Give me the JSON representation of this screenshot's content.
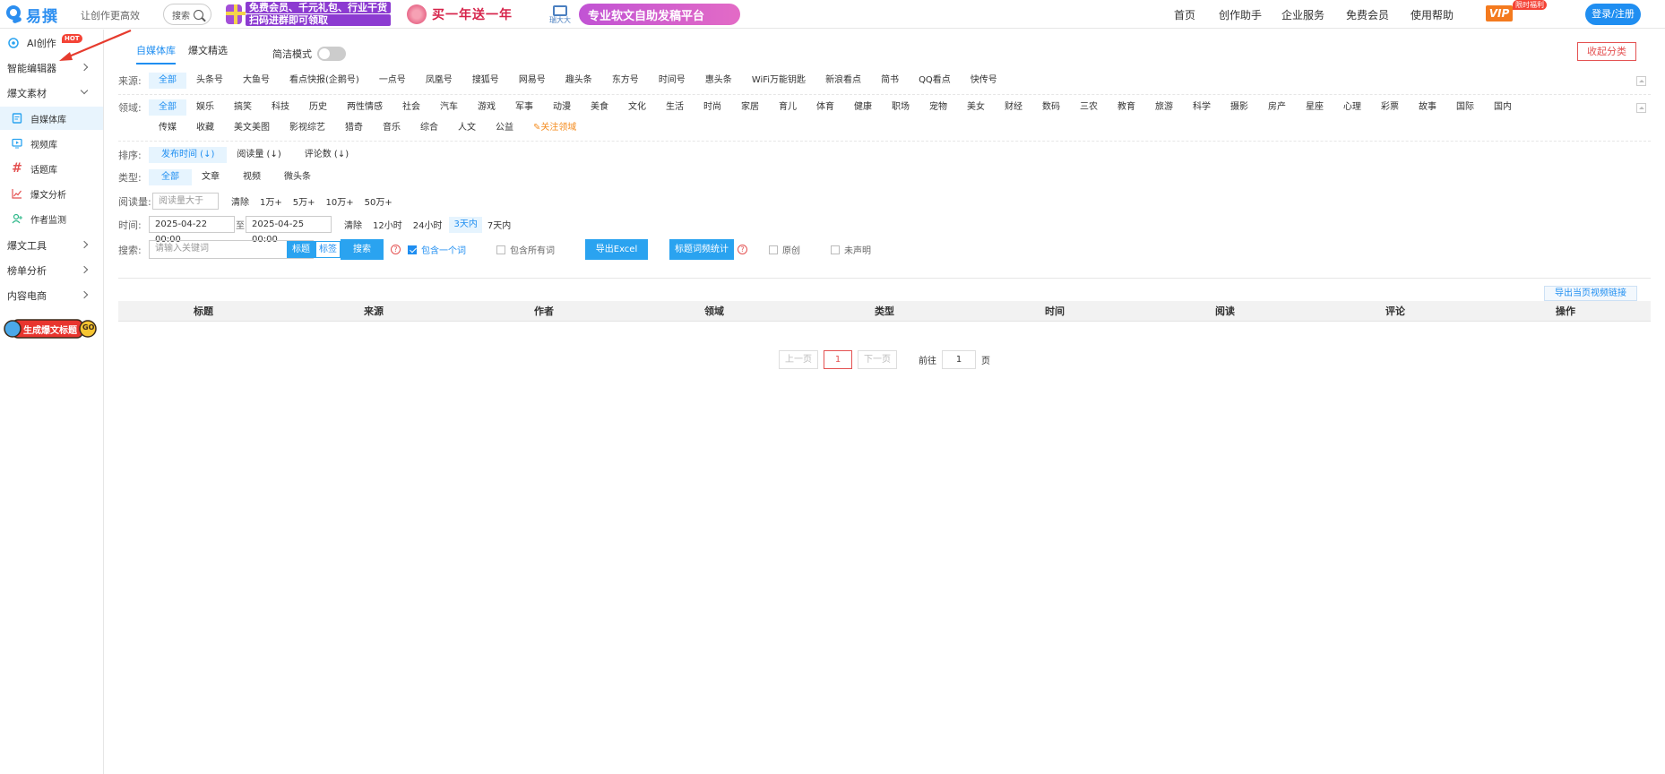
{
  "header": {
    "logo_text": "易撰",
    "tagline": "让创作更高效",
    "search_label": "搜索",
    "banner1_line1": "免费会员、千元礼包、行业干货",
    "banner1_line2": "扫码进群即可领取",
    "banner2_text": "买一年送一年",
    "banner3_brand": "瑞大大",
    "banner3_text": "专业软文自助发稿平台",
    "nav": [
      "首页",
      "创作助手",
      "企业服务",
      "免费会员",
      "使用帮助"
    ],
    "vip": "VIP",
    "vip_tag": "限时福利",
    "login": "登录/注册"
  },
  "sidebar": {
    "ai": "AI创作",
    "hot": "HOT",
    "editor": "智能编辑器",
    "material": "爆文素材",
    "items": [
      "自媒体库",
      "视频库",
      "话题库",
      "爆文分析",
      "作者监测"
    ],
    "tools": "爆文工具",
    "rank": "榜单分析",
    "ecom": "内容电商",
    "promo": "生成爆文标题",
    "promo_go": "GO"
  },
  "main": {
    "tabs": [
      "自媒体库",
      "爆文精选"
    ],
    "simple_mode": "简洁模式",
    "collapse": "收起分类",
    "source_label": "来源:",
    "sources": [
      "全部",
      "头条号",
      "大鱼号",
      "看点快报(企鹅号)",
      "一点号",
      "凤凰号",
      "搜狐号",
      "网易号",
      "趣头条",
      "东方号",
      "时间号",
      "惠头条",
      "WiFi万能钥匙",
      "新浪看点",
      "简书",
      "QQ看点",
      "快传号"
    ],
    "field_label": "领域:",
    "fields1": [
      "全部",
      "娱乐",
      "搞笑",
      "科技",
      "历史",
      "两性情感",
      "社会",
      "汽车",
      "游戏",
      "军事",
      "动漫",
      "美食",
      "文化",
      "生活",
      "时尚",
      "家居",
      "育儿",
      "体育",
      "健康",
      "职场",
      "宠物",
      "美女",
      "财经",
      "数码",
      "三农",
      "教育",
      "旅游",
      "科学",
      "摄影",
      "房产",
      "星座",
      "心理",
      "彩票",
      "故事",
      "国际",
      "国内"
    ],
    "fields2": [
      "传媒",
      "收藏",
      "美文美图",
      "影视综艺",
      "猎奇",
      "音乐",
      "综合",
      "人文",
      "公益"
    ],
    "follow_field": "关注领域",
    "sort_label": "排序:",
    "sorts": [
      "发布时间 (↓)",
      "阅读量 (↓)",
      "评论数 (↓)"
    ],
    "type_label": "类型:",
    "types": [
      "全部",
      "文章",
      "视频",
      "微头条"
    ],
    "reads_label": "阅读量:",
    "reads_placeholder": "阅读量大于",
    "reads_options": [
      "清除",
      "1万+",
      "5万+",
      "10万+",
      "50万+"
    ],
    "time_label": "时间:",
    "time_start": "2025-04-22 00:00",
    "time_to": "至",
    "time_end": "2025-04-25 00:00",
    "time_options": [
      "清除",
      "12小时",
      "24小时",
      "3天内",
      "7天内"
    ],
    "search_label": "搜索:",
    "search_placeholder": "请输入关键词",
    "search_mode": [
      "标题",
      "标签"
    ],
    "search_btn": "搜索",
    "include_one": "包含一个词",
    "include_all": "包含所有词",
    "export_excel": "导出Excel",
    "title_stats": "标题词频统计",
    "original": "原创",
    "no_claim": "未声明",
    "export_video": "导出当页视频链接",
    "table_headers": [
      "标题",
      "来源",
      "作者",
      "领域",
      "类型",
      "时间",
      "阅读",
      "评论",
      "操作"
    ],
    "pager": {
      "prev": "上一页",
      "current": "1",
      "next": "下一页",
      "goto": "前往",
      "page_value": "1",
      "unit": "页"
    }
  }
}
